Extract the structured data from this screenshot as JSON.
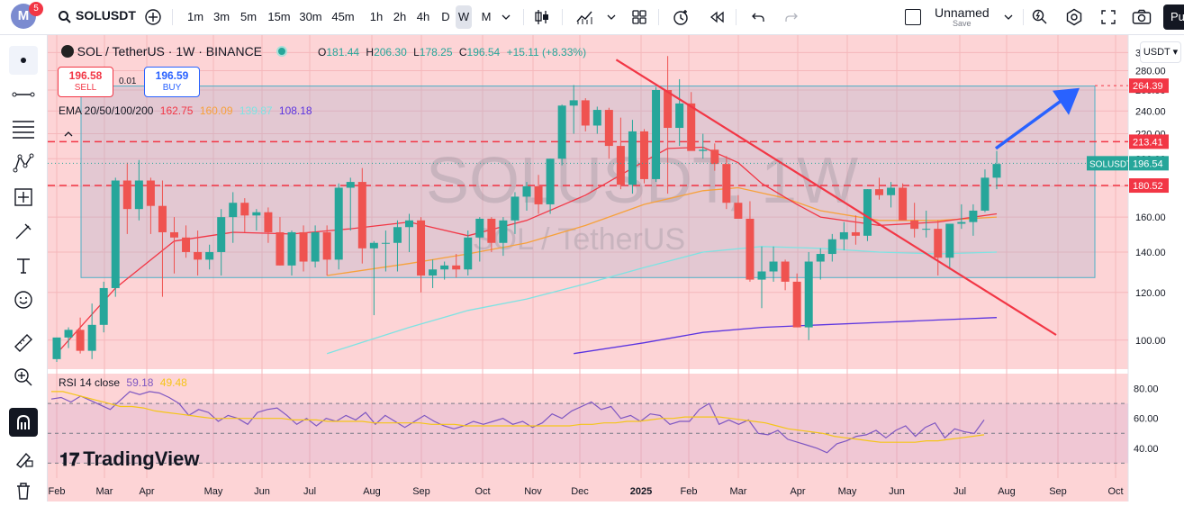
{
  "toolbar": {
    "avatar_letter": "M",
    "notification_count": "5",
    "symbol": "SOLUSDT",
    "intervals": [
      "1m",
      "3m",
      "5m",
      "15m",
      "30m",
      "45m",
      "1h",
      "2h",
      "4h",
      "D",
      "W",
      "M"
    ],
    "active_interval": "W",
    "layout_name": "Unnamed",
    "save_label": "Save",
    "publish_label": "Pu"
  },
  "legend": {
    "symbol_line": "SOL / TetherUS · 1W · BINANCE",
    "open_label": "O",
    "open": "181.44",
    "high_label": "H",
    "high": "206.30",
    "low_label": "L",
    "low": "178.25",
    "close_label": "C",
    "close": "196.54",
    "change": "+15.11 (+8.33%)",
    "sell_price": "196.58",
    "sell_label": "SELL",
    "spread": "0.01",
    "buy_price": "196.59",
    "buy_label": "BUY",
    "ema_label": "EMA 20/50/100/200",
    "ema20": "162.75",
    "ema50": "160.09",
    "ema100": "139.87",
    "ema200": "108.18",
    "rsi_label": "RSI 14 close",
    "rsi_value": "59.18",
    "rsi_ma": "49.48"
  },
  "watermark": {
    "main": "SOLUSDT, 1W",
    "sub": "SOL / TetherUS"
  },
  "currency": "USDT",
  "colors": {
    "up": "#26a69a",
    "down": "#ef5350",
    "bg": "#fdd4d6",
    "ema20": "#f23645",
    "ema50": "#f7a13a",
    "ema100": "#7ee3e3",
    "ema200": "#5b34e0",
    "rsi": "#7e57c2",
    "rsi_ma": "#f5c518",
    "trendline": "#f23645",
    "arrow": "#2962ff"
  },
  "branding": "TradingView",
  "chart_data": {
    "type": "candlestick",
    "title": "SOLUSDT, 1W",
    "price_axis_ticks": [
      100,
      120,
      140,
      160,
      180,
      200,
      220,
      240,
      260,
      280,
      300
    ],
    "price_axis_labels": [
      "100.00",
      "120.00",
      "140.00",
      "160.00",
      "180.00",
      "200.00",
      "220.00",
      "240.00",
      "260.00",
      "280.00",
      "300.00"
    ],
    "ylim": [
      92,
      312
    ],
    "time_axis_labels": [
      "Feb",
      "Mar",
      "Apr",
      "May",
      "Jun",
      "Jul",
      "Aug",
      "Sep",
      "Oct",
      "Nov",
      "Dec",
      "2025",
      "Feb",
      "Mar",
      "Apr",
      "May",
      "Jun",
      "Jul",
      "Aug",
      "Sep",
      "Oct"
    ],
    "candles": [
      [
        93,
        101,
        92,
        101
      ],
      [
        101,
        105,
        97,
        104
      ],
      [
        104,
        109,
        95,
        96
      ],
      [
        96,
        115,
        93,
        106
      ],
      [
        106,
        125,
        103,
        122
      ],
      [
        122,
        186,
        118,
        184
      ],
      [
        184,
        197,
        150,
        165
      ],
      [
        165,
        199,
        158,
        184
      ],
      [
        184,
        186,
        150,
        167
      ],
      [
        167,
        184,
        118,
        151
      ],
      [
        151,
        160,
        129,
        148
      ],
      [
        148,
        155,
        137,
        140
      ],
      [
        140,
        152,
        128,
        136
      ],
      [
        136,
        144,
        131,
        140
      ],
      [
        140,
        165,
        128,
        160
      ],
      [
        160,
        176,
        145,
        169
      ],
      [
        169,
        172,
        151,
        161
      ],
      [
        161,
        165,
        152,
        163
      ],
      [
        163,
        166,
        145,
        151
      ],
      [
        151,
        160,
        133,
        133
      ],
      [
        133,
        152,
        128,
        151
      ],
      [
        151,
        155,
        130,
        135
      ],
      [
        135,
        155,
        132,
        151
      ],
      [
        151,
        155,
        128,
        136
      ],
      [
        136,
        182,
        131,
        179
      ],
      [
        179,
        186,
        152,
        183
      ],
      [
        183,
        193,
        134,
        142
      ],
      [
        142,
        146,
        110,
        145
      ],
      [
        145,
        152,
        130,
        145
      ],
      [
        145,
        158,
        130,
        154
      ],
      [
        154,
        162,
        140,
        158
      ],
      [
        158,
        160,
        120,
        128
      ],
      [
        128,
        136,
        122,
        131
      ],
      [
        131,
        135,
        126,
        133
      ],
      [
        133,
        139,
        127,
        131
      ],
      [
        131,
        152,
        128,
        148
      ],
      [
        148,
        160,
        135,
        159
      ],
      [
        159,
        160,
        140,
        145
      ],
      [
        145,
        160,
        138,
        158
      ],
      [
        158,
        176,
        150,
        173
      ],
      [
        173,
        183,
        164,
        180
      ],
      [
        180,
        188,
        162,
        168
      ],
      [
        168,
        200,
        162,
        200
      ],
      [
        200,
        246,
        195,
        245
      ],
      [
        245,
        265,
        220,
        250
      ],
      [
        250,
        252,
        222,
        227
      ],
      [
        227,
        244,
        220,
        241
      ],
      [
        241,
        243,
        200,
        210
      ],
      [
        210,
        234,
        178,
        181
      ],
      [
        181,
        232,
        175,
        222
      ],
      [
        222,
        224,
        182,
        185
      ],
      [
        185,
        263,
        183,
        260
      ],
      [
        260,
        296,
        175,
        225
      ],
      [
        225,
        271,
        210,
        247
      ],
      [
        247,
        258,
        220,
        206
      ],
      [
        206,
        220,
        200,
        207
      ],
      [
        207,
        212,
        191,
        196
      ],
      [
        196,
        202,
        165,
        169
      ],
      [
        169,
        174,
        162,
        159
      ],
      [
        159,
        170,
        125,
        126
      ],
      [
        126,
        143,
        113,
        130
      ],
      [
        130,
        143,
        125,
        135
      ],
      [
        135,
        136,
        121,
        125
      ],
      [
        125,
        129,
        105,
        105
      ],
      [
        105,
        140,
        100,
        135
      ],
      [
        135,
        142,
        126,
        139
      ],
      [
        139,
        150,
        135,
        147
      ],
      [
        147,
        157,
        141,
        151
      ],
      [
        151,
        161,
        144,
        149
      ],
      [
        149,
        178,
        146,
        178
      ],
      [
        178,
        186,
        171,
        174
      ],
      [
        174,
        183,
        166,
        179
      ],
      [
        179,
        182,
        160,
        158
      ],
      [
        158,
        169,
        148,
        153
      ],
      [
        153,
        164,
        148,
        153
      ],
      [
        153,
        158,
        128,
        137
      ],
      [
        137,
        150,
        131,
        156
      ],
      [
        156,
        168,
        153,
        157
      ],
      [
        157,
        168,
        149,
        164
      ],
      [
        164,
        192,
        163,
        186
      ],
      [
        186,
        206,
        178,
        196
      ]
    ],
    "ema20_points": [
      [
        0,
        95
      ],
      [
        5,
        122
      ],
      [
        10,
        146
      ],
      [
        15,
        151
      ],
      [
        20,
        150
      ],
      [
        25,
        153
      ],
      [
        30,
        157
      ],
      [
        35,
        149
      ],
      [
        40,
        158
      ],
      [
        45,
        174
      ],
      [
        50,
        198
      ],
      [
        52,
        208
      ],
      [
        55,
        209
      ],
      [
        58,
        197
      ],
      [
        60,
        182
      ],
      [
        63,
        168
      ],
      [
        65,
        160
      ],
      [
        70,
        155
      ],
      [
        75,
        157
      ],
      [
        80,
        162
      ]
    ],
    "ema50_points": [
      [
        23,
        128
      ],
      [
        30,
        134
      ],
      [
        35,
        139
      ],
      [
        40,
        145
      ],
      [
        45,
        155
      ],
      [
        50,
        168
      ],
      [
        55,
        177
      ],
      [
        58,
        179
      ],
      [
        62,
        172
      ],
      [
        65,
        164
      ],
      [
        70,
        158
      ],
      [
        75,
        158
      ],
      [
        80,
        160
      ]
    ],
    "ema100_points": [
      [
        23,
        95
      ],
      [
        30,
        105
      ],
      [
        35,
        112
      ],
      [
        40,
        117
      ],
      [
        45,
        124
      ],
      [
        50,
        132
      ],
      [
        55,
        140
      ],
      [
        60,
        143
      ],
      [
        65,
        142
      ],
      [
        70,
        140
      ],
      [
        75,
        139
      ],
      [
        80,
        140
      ]
    ],
    "ema200_points": [
      [
        44,
        95
      ],
      [
        50,
        99
      ],
      [
        55,
        103
      ],
      [
        60,
        105
      ],
      [
        65,
        106
      ],
      [
        70,
        107
      ],
      [
        75,
        108
      ],
      [
        80,
        109
      ]
    ],
    "horizontal_levels": [
      264.39,
      213.41,
      180.52
    ],
    "range_box": [
      127,
      264
    ],
    "current_price": 196.54,
    "rsi": {
      "ticks": [
        40,
        60,
        80
      ],
      "tick_labels": [
        "40.00",
        "60.00",
        "80.00"
      ],
      "levels": [
        30,
        50,
        70
      ],
      "values": [
        73,
        74,
        71,
        75,
        72,
        69,
        66,
        72,
        78,
        76,
        78,
        77,
        74,
        70,
        62,
        66,
        64,
        58,
        62,
        60,
        56,
        64,
        66,
        67,
        62,
        56,
        60,
        55,
        60,
        58,
        62,
        59,
        64,
        56,
        62,
        58,
        54,
        58,
        62,
        58,
        55,
        53,
        55,
        58,
        56,
        58,
        60,
        56,
        58,
        54,
        57,
        63,
        60,
        65,
        68,
        71,
        66,
        68,
        60,
        62,
        58,
        63,
        62,
        56,
        58,
        58,
        66,
        70,
        56,
        59,
        56,
        59,
        50,
        49,
        52,
        46,
        44,
        42,
        40,
        37,
        43,
        45,
        48,
        49,
        52,
        47,
        52,
        55,
        48,
        54,
        57,
        47,
        53,
        51,
        50,
        59
      ],
      "ma_values": [
        78,
        78,
        76,
        74,
        72,
        70,
        68,
        68,
        67,
        65,
        64,
        63,
        62,
        61,
        60,
        60,
        60,
        60,
        60,
        60,
        60,
        59,
        59,
        59,
        58,
        58,
        58,
        58,
        57,
        57,
        57,
        57,
        57,
        56,
        56,
        56,
        55,
        55,
        55,
        55,
        55,
        55,
        55,
        55,
        55,
        55,
        56,
        56,
        57,
        57,
        58,
        58,
        59,
        60,
        60,
        61,
        61,
        61,
        61,
        60,
        59,
        58,
        57,
        55,
        53,
        52,
        51,
        50,
        48,
        47,
        46,
        45,
        44,
        44,
        44,
        44,
        45,
        45,
        46,
        47,
        48,
        49
      ]
    },
    "time_labels_below": [
      "Feb",
      "Mar",
      "Apr",
      "May",
      "Jun",
      "Jul",
      "Aug",
      "Sep",
      "Oct",
      "Nov",
      "Dec",
      "2025",
      "Feb",
      "Mar",
      "Apr",
      "May",
      "Jun",
      "Jul",
      "Aug",
      "Sep",
      "Oct"
    ]
  }
}
